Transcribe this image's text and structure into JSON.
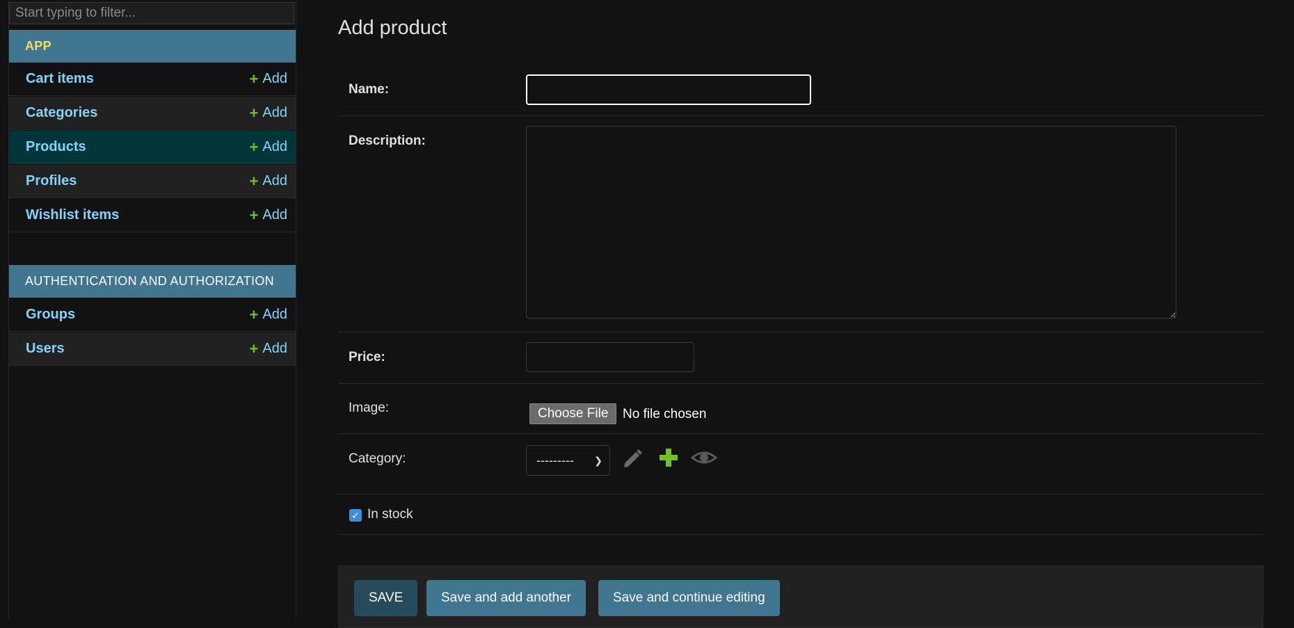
{
  "sidebar": {
    "filter_placeholder": "Start typing to filter...",
    "modules": [
      {
        "title": "APP",
        "items": [
          {
            "label": "Cart items",
            "add": "Add"
          },
          {
            "label": "Categories",
            "add": "Add"
          },
          {
            "label": "Products",
            "add": "Add"
          },
          {
            "label": "Profiles",
            "add": "Add"
          },
          {
            "label": "Wishlist items",
            "add": "Add"
          }
        ]
      },
      {
        "title": "AUTHENTICATION AND AUTHORIZATION",
        "items": [
          {
            "label": "Groups",
            "add": "Add"
          },
          {
            "label": "Users",
            "add": "Add"
          }
        ]
      }
    ]
  },
  "main": {
    "title": "Add product",
    "fields": {
      "name": {
        "label": "Name:",
        "value": ""
      },
      "description": {
        "label": "Description:",
        "value": ""
      },
      "price": {
        "label": "Price:",
        "value": ""
      },
      "image": {
        "label": "Image:",
        "button": "Choose File",
        "status": "No file chosen"
      },
      "category": {
        "label": "Category:",
        "selected": "---------"
      },
      "in_stock": {
        "label": "In stock",
        "checked": true
      }
    },
    "buttons": {
      "save": "SAVE",
      "save_add_another": "Save and add another",
      "save_continue": "Save and continue editing"
    }
  },
  "colors": {
    "module_header": "#417690",
    "link": "#81d4fa",
    "add_plus": "#70bf2b",
    "selected_row": "#00363a",
    "primary_button": "#264b5d"
  }
}
